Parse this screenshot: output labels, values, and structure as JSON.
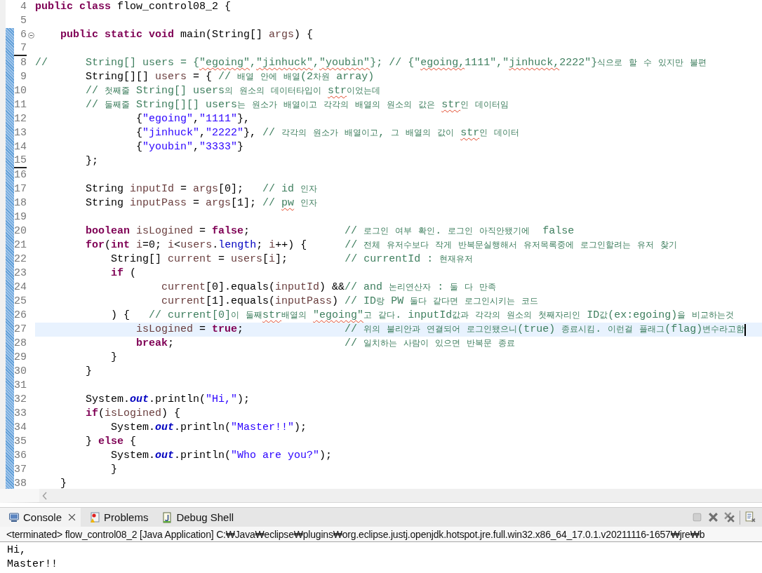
{
  "editor": {
    "lines": [
      {
        "number": "4",
        "underlined": false,
        "current_line": false,
        "foldable": false,
        "tokens": [
          {
            "kind": "keyword",
            "text": "public class"
          },
          {
            "kind": "plain",
            "text": " flow_control08_2 {"
          }
        ]
      },
      {
        "number": "5",
        "underlined": false,
        "current_line": false,
        "foldable": false
      },
      {
        "number": "6",
        "underlined": false,
        "current_line": false,
        "foldable": true,
        "tokens": [
          {
            "kind": "keyword",
            "text": "    public static void"
          },
          {
            "kind": "plain",
            "text": " main(String[] "
          },
          {
            "kind": "variable",
            "text": "args"
          },
          {
            "kind": "plain",
            "text": ") {"
          }
        ]
      },
      {
        "number": "7",
        "underlined": true,
        "current_line": false,
        "foldable": false
      },
      {
        "number": "8",
        "underlined": false,
        "current_line": false,
        "foldable": false,
        "tokens": [
          {
            "kind": "comment",
            "text": "//      String[] users = {"
          },
          {
            "kind": "comment_typo",
            "text": "\"egoing\""
          },
          {
            "kind": "comment",
            "text": ","
          },
          {
            "kind": "comment_typo",
            "text": "\"jinhuck\""
          },
          {
            "kind": "comment",
            "text": ","
          },
          {
            "kind": "comment_typo",
            "text": "\"youbin\""
          },
          {
            "kind": "comment",
            "text": "}; // {\""
          },
          {
            "kind": "comment_typo",
            "text": "egoing,"
          },
          {
            "kind": "comment",
            "text": "1111\",\""
          },
          {
            "kind": "comment_typo",
            "text": "jinhuck,"
          },
          {
            "kind": "comment",
            "text": "2222\"}식으로 할 수 있지만 불편"
          }
        ]
      },
      {
        "number": "9",
        "underlined": false,
        "current_line": false,
        "foldable": false,
        "tokens": [
          {
            "kind": "plain",
            "text": "        String[][] "
          },
          {
            "kind": "variable",
            "text": "users"
          },
          {
            "kind": "plain",
            "text": " = { "
          },
          {
            "kind": "comment",
            "text": "// 배열 안에 배열(2차원 array)"
          }
        ]
      },
      {
        "number": "10",
        "underlined": false,
        "current_line": false,
        "foldable": false,
        "tokens": [
          {
            "kind": "comment",
            "text": "        // 첫째줄 String[] users의 원소의 데이터타입이 "
          },
          {
            "kind": "comment_typo",
            "text": "str"
          },
          {
            "kind": "comment",
            "text": "이었는데"
          }
        ]
      },
      {
        "number": "11",
        "underlined": false,
        "current_line": false,
        "foldable": false,
        "tokens": [
          {
            "kind": "comment",
            "text": "        // 둘째줄 String[][] users는 원소가 배열이고 각각의 배열의 원소의 값은 "
          },
          {
            "kind": "comment_typo",
            "text": "str"
          },
          {
            "kind": "comment",
            "text": "인 데이터임"
          }
        ]
      },
      {
        "number": "12",
        "underlined": false,
        "current_line": false,
        "foldable": false,
        "tokens": [
          {
            "kind": "plain",
            "text": "                {"
          },
          {
            "kind": "string",
            "text": "\"egoing\""
          },
          {
            "kind": "plain",
            "text": ","
          },
          {
            "kind": "string",
            "text": "\"1111\""
          },
          {
            "kind": "plain",
            "text": "},"
          }
        ]
      },
      {
        "number": "13",
        "underlined": false,
        "current_line": false,
        "foldable": false,
        "tokens": [
          {
            "kind": "plain",
            "text": "                {"
          },
          {
            "kind": "string",
            "text": "\"jinhuck\""
          },
          {
            "kind": "plain",
            "text": ","
          },
          {
            "kind": "string",
            "text": "\"2222\""
          },
          {
            "kind": "plain",
            "text": "}, "
          },
          {
            "kind": "comment",
            "text": "// 각각의 원소가 배열이고, 그 배열의 값이 "
          },
          {
            "kind": "comment_typo",
            "text": "str"
          },
          {
            "kind": "comment",
            "text": "인 데이터"
          }
        ]
      },
      {
        "number": "14",
        "underlined": false,
        "current_line": false,
        "foldable": false,
        "tokens": [
          {
            "kind": "plain",
            "text": "                {"
          },
          {
            "kind": "string",
            "text": "\"youbin\""
          },
          {
            "kind": "plain",
            "text": ","
          },
          {
            "kind": "string",
            "text": "\"3333\""
          },
          {
            "kind": "plain",
            "text": "}"
          }
        ]
      },
      {
        "number": "15",
        "underlined": true,
        "current_line": false,
        "foldable": false,
        "tokens": [
          {
            "kind": "plain",
            "text": "        };"
          }
        ]
      },
      {
        "number": "16",
        "underlined": false,
        "current_line": false,
        "foldable": false
      },
      {
        "number": "17",
        "underlined": false,
        "current_line": false,
        "foldable": false,
        "tokens": [
          {
            "kind": "plain",
            "text": "        String "
          },
          {
            "kind": "variable",
            "text": "inputId"
          },
          {
            "kind": "plain",
            "text": " = "
          },
          {
            "kind": "variable",
            "text": "args"
          },
          {
            "kind": "plain",
            "text": "[0];   "
          },
          {
            "kind": "comment",
            "text": "// id 인자"
          }
        ]
      },
      {
        "number": "18",
        "underlined": false,
        "current_line": false,
        "foldable": false,
        "tokens": [
          {
            "kind": "plain",
            "text": "        String "
          },
          {
            "kind": "variable",
            "text": "inputPass"
          },
          {
            "kind": "plain",
            "text": " = "
          },
          {
            "kind": "variable",
            "text": "args"
          },
          {
            "kind": "plain",
            "text": "[1]; "
          },
          {
            "kind": "comment",
            "text": "// "
          },
          {
            "kind": "comment_typo",
            "text": "pw"
          },
          {
            "kind": "comment",
            "text": " 인자"
          }
        ]
      },
      {
        "number": "19",
        "underlined": false,
        "current_line": false,
        "foldable": false
      },
      {
        "number": "20",
        "underlined": false,
        "current_line": false,
        "foldable": false,
        "tokens": [
          {
            "kind": "keyword",
            "text": "        boolean "
          },
          {
            "kind": "variable",
            "text": "isLogined"
          },
          {
            "kind": "plain",
            "text": " = "
          },
          {
            "kind": "keyword",
            "text": "false"
          },
          {
            "kind": "plain",
            "text": ";               "
          },
          {
            "kind": "comment",
            "text": "// 로그인 여부 확인. 로그인 아직안됐기에  false"
          }
        ]
      },
      {
        "number": "21",
        "underlined": false,
        "current_line": false,
        "foldable": false,
        "tokens": [
          {
            "kind": "keyword",
            "text": "        for"
          },
          {
            "kind": "plain",
            "text": "("
          },
          {
            "kind": "keyword",
            "text": "int "
          },
          {
            "kind": "variable",
            "text": "i"
          },
          {
            "kind": "plain",
            "text": "=0; "
          },
          {
            "kind": "variable",
            "text": "i"
          },
          {
            "kind": "plain",
            "text": "<"
          },
          {
            "kind": "variable",
            "text": "users"
          },
          {
            "kind": "plain",
            "text": "."
          },
          {
            "kind": "field",
            "text": "length"
          },
          {
            "kind": "plain",
            "text": "; "
          },
          {
            "kind": "variable",
            "text": "i"
          },
          {
            "kind": "plain",
            "text": "++) {      "
          },
          {
            "kind": "comment",
            "text": "// 전체 유저수보다 작게 반복문실행해서 유저목록중에 로그인할려는 유저 찾기"
          }
        ]
      },
      {
        "number": "22",
        "underlined": false,
        "current_line": false,
        "foldable": false,
        "tokens": [
          {
            "kind": "plain",
            "text": "            String[] "
          },
          {
            "kind": "variable",
            "text": "current"
          },
          {
            "kind": "plain",
            "text": " = "
          },
          {
            "kind": "variable",
            "text": "users"
          },
          {
            "kind": "plain",
            "text": "["
          },
          {
            "kind": "variable",
            "text": "i"
          },
          {
            "kind": "plain",
            "text": "];         "
          },
          {
            "kind": "comment",
            "text": "// currentId : 현재유저"
          }
        ]
      },
      {
        "number": "23",
        "underlined": false,
        "current_line": false,
        "foldable": false,
        "tokens": [
          {
            "kind": "keyword",
            "text": "            if"
          },
          {
            "kind": "plain",
            "text": " ("
          }
        ]
      },
      {
        "number": "24",
        "underlined": false,
        "current_line": false,
        "foldable": false,
        "tokens": [
          {
            "kind": "variable",
            "text": "                    current"
          },
          {
            "kind": "plain",
            "text": "[0].equals("
          },
          {
            "kind": "variable",
            "text": "inputId"
          },
          {
            "kind": "plain",
            "text": ") &&"
          },
          {
            "kind": "comment",
            "text": "// and 논리연산자 : 둘 다 만족"
          }
        ]
      },
      {
        "number": "25",
        "underlined": false,
        "current_line": false,
        "foldable": false,
        "tokens": [
          {
            "kind": "variable",
            "text": "                    current"
          },
          {
            "kind": "plain",
            "text": "[1].equals("
          },
          {
            "kind": "variable",
            "text": "inputPass"
          },
          {
            "kind": "plain",
            "text": ") "
          },
          {
            "kind": "comment",
            "text": "// ID랑 PW 둘다 같다면 로그인시키는 코드"
          }
        ]
      },
      {
        "number": "26",
        "underlined": false,
        "current_line": false,
        "foldable": false,
        "tokens": [
          {
            "kind": "plain",
            "text": "            ) {   "
          },
          {
            "kind": "comment",
            "text": "// current[0]이 둘째"
          },
          {
            "kind": "comment_typo",
            "text": "str"
          },
          {
            "kind": "comment",
            "text": "배열의 "
          },
          {
            "kind": "comment_typo",
            "text": "\"egoing\""
          },
          {
            "kind": "comment",
            "text": "고 같다. inputId값과 각각의 원소의 첫째자리인 ID값(ex:egoing)을 비교하는것"
          }
        ]
      },
      {
        "number": "27",
        "underlined": false,
        "current_line": true,
        "foldable": false,
        "tokens": [
          {
            "kind": "variable",
            "text": "                isLogined"
          },
          {
            "kind": "plain",
            "text": " = "
          },
          {
            "kind": "keyword",
            "text": "true"
          },
          {
            "kind": "plain",
            "text": ";                "
          },
          {
            "kind": "comment",
            "text": "// 위의 불리안과 연결되어 로그인됐으니(true) 종료시킴. 이런걸 플래그(flag)변수라고함"
          }
        ]
      },
      {
        "number": "28",
        "underlined": false,
        "current_line": false,
        "foldable": false,
        "tokens": [
          {
            "kind": "keyword",
            "text": "                break"
          },
          {
            "kind": "plain",
            "text": ";                           "
          },
          {
            "kind": "comment",
            "text": "// 일치하는 사람이 있으면 반복문 종료"
          }
        ]
      },
      {
        "number": "29",
        "underlined": false,
        "current_line": false,
        "foldable": false,
        "tokens": [
          {
            "kind": "plain",
            "text": "            }"
          }
        ]
      },
      {
        "number": "30",
        "underlined": false,
        "current_line": false,
        "foldable": false,
        "tokens": [
          {
            "kind": "plain",
            "text": "        }"
          }
        ]
      },
      {
        "number": "31",
        "underlined": false,
        "current_line": false,
        "foldable": false
      },
      {
        "number": "32",
        "underlined": false,
        "current_line": false,
        "foldable": false,
        "tokens": [
          {
            "kind": "plain",
            "text": "        System."
          },
          {
            "kind": "static_field",
            "text": "out"
          },
          {
            "kind": "plain",
            "text": ".println("
          },
          {
            "kind": "string",
            "text": "\"Hi,\""
          },
          {
            "kind": "plain",
            "text": ");"
          }
        ]
      },
      {
        "number": "33",
        "underlined": false,
        "current_line": false,
        "foldable": false,
        "tokens": [
          {
            "kind": "keyword",
            "text": "        if"
          },
          {
            "kind": "plain",
            "text": "("
          },
          {
            "kind": "variable",
            "text": "isLogined"
          },
          {
            "kind": "plain",
            "text": ") {"
          }
        ]
      },
      {
        "number": "34",
        "underlined": false,
        "current_line": false,
        "foldable": false,
        "tokens": [
          {
            "kind": "plain",
            "text": "            System."
          },
          {
            "kind": "static_field",
            "text": "out"
          },
          {
            "kind": "plain",
            "text": ".println("
          },
          {
            "kind": "string",
            "text": "\"Master!!\""
          },
          {
            "kind": "plain",
            "text": ");"
          }
        ]
      },
      {
        "number": "35",
        "underlined": false,
        "current_line": false,
        "foldable": false,
        "tokens": [
          {
            "kind": "plain",
            "text": "        } "
          },
          {
            "kind": "keyword",
            "text": "else"
          },
          {
            "kind": "plain",
            "text": " {"
          }
        ]
      },
      {
        "number": "36",
        "underlined": false,
        "current_line": false,
        "foldable": false,
        "tokens": [
          {
            "kind": "plain",
            "text": "            System."
          },
          {
            "kind": "static_field",
            "text": "out"
          },
          {
            "kind": "plain",
            "text": ".println("
          },
          {
            "kind": "string",
            "text": "\"Who are you?\""
          },
          {
            "kind": "plain",
            "text": ");"
          }
        ]
      },
      {
        "number": "37",
        "underlined": false,
        "current_line": false,
        "foldable": false,
        "tokens": [
          {
            "kind": "plain",
            "text": "            }"
          }
        ]
      },
      {
        "number": "38",
        "underlined": false,
        "current_line": false,
        "foldable": false,
        "tokens": [
          {
            "kind": "plain",
            "text": "    }"
          }
        ]
      }
    ]
  },
  "panel": {
    "tabs": [
      {
        "label": "Console",
        "selected": true,
        "closable": true,
        "kind": "console"
      },
      {
        "label": "Problems",
        "selected": false,
        "closable": false,
        "kind": "problems"
      },
      {
        "label": "Debug Shell",
        "selected": false,
        "closable": false,
        "kind": "debug"
      }
    ],
    "process_label": "<terminated> flow_control08_2 [Java Application] C:₩Java₩eclipse₩plugins₩org.eclipse.justj.openjdk.hotspot.jre.full.win32.x86_64_17.0.1.v20211116-1657₩jre₩b",
    "output": [
      "Hi,",
      "Master!!"
    ]
  }
}
